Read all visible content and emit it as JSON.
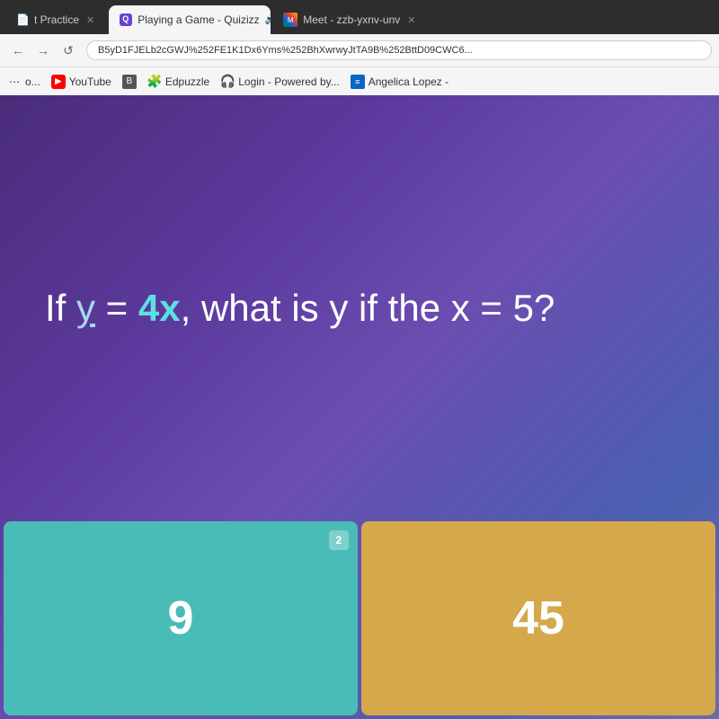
{
  "browser": {
    "tabs": [
      {
        "id": "tab-practice",
        "label": "t Practice",
        "active": false,
        "has_close": true,
        "icon": "practice-icon"
      },
      {
        "id": "tab-quizizz",
        "label": "Playing a Game - Quizizz",
        "active": true,
        "has_close": true,
        "has_audio": true,
        "icon": "quizizz-icon"
      },
      {
        "id": "tab-meet",
        "label": "Meet - zzb-yxnv-unv",
        "active": false,
        "has_close": true,
        "icon": "meet-icon"
      }
    ],
    "url": "B5yD1FJELb2cGWJ%252FE1K1Dx6Yms%252BhXwrwyJtTA9B%252BttD09CWC6...",
    "bookmarks": [
      {
        "id": "bm-dots",
        "label": "o...",
        "icon": "dots-icon"
      },
      {
        "id": "bm-youtube",
        "label": "YouTube",
        "icon": "youtube-icon"
      },
      {
        "id": "bm-unknown",
        "label": "",
        "icon": "unknown-icon"
      },
      {
        "id": "bm-edpuzzle",
        "label": "Edpuzzle",
        "icon": "edpuzzle-icon"
      },
      {
        "id": "bm-login",
        "label": "Login - Powered by...",
        "icon": "login-icon"
      },
      {
        "id": "bm-angelica",
        "label": "Angelica Lopez -",
        "icon": "angelica-icon"
      }
    ]
  },
  "question": {
    "text_before": "If ",
    "var_y": "y",
    "text_equals": " = ",
    "val_4x": "4x",
    "text_after": ", what is y if the x = 5?"
  },
  "answers": [
    {
      "id": "answer-9",
      "value": "9",
      "number": "2",
      "color": "teal"
    },
    {
      "id": "answer-45",
      "value": "45",
      "number": "",
      "color": "gold"
    }
  ]
}
